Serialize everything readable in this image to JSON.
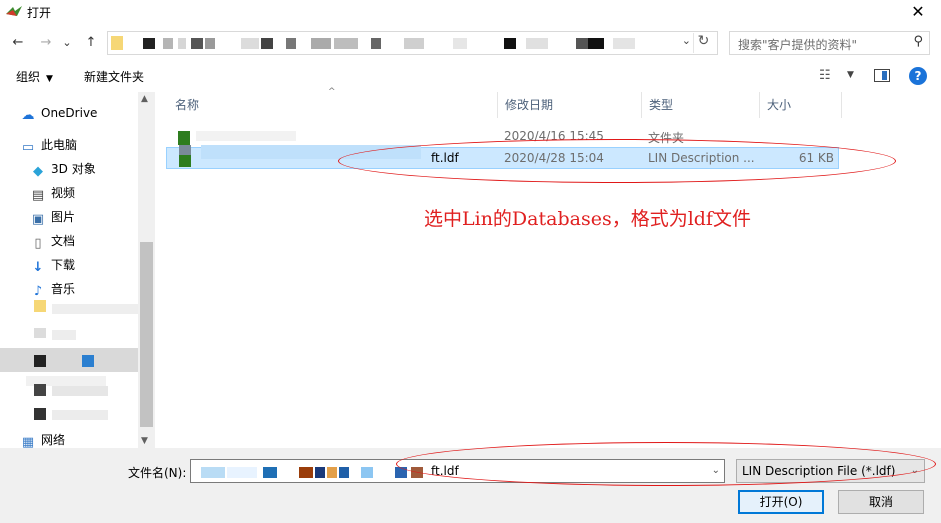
{
  "window": {
    "title": "打开",
    "close_glyph": "✕"
  },
  "nav": {
    "back_glyph": "←",
    "forward_glyph": "→",
    "recent_glyph": "⌄",
    "up_glyph": "↑",
    "address_drop_glyph": "⌄",
    "refresh_glyph": "↻",
    "search_placeholder": "搜索\"客户提供的资料\"",
    "search_glyph": "⚲"
  },
  "toolbar": {
    "organize": "组织",
    "organize_arrow": "▼",
    "new_folder": "新建文件夹",
    "view_glyph": "☷",
    "view_drop": "▼",
    "help": "?"
  },
  "sidebar": {
    "items": [
      {
        "label": "OneDrive",
        "icon": "cloud-icon",
        "glyph": "☁"
      },
      {
        "label": "此电脑",
        "icon": "computer-icon",
        "glyph": "▭"
      },
      {
        "label": "3D 对象",
        "icon": "cube-icon",
        "glyph": "◆"
      },
      {
        "label": "视频",
        "icon": "video-icon",
        "glyph": "▤"
      },
      {
        "label": "图片",
        "icon": "picture-icon",
        "glyph": "▣"
      },
      {
        "label": "文档",
        "icon": "document-icon",
        "glyph": "▯"
      },
      {
        "label": "下载",
        "icon": "download-icon",
        "glyph": "↓"
      },
      {
        "label": "音乐",
        "icon": "music-icon",
        "glyph": "♪"
      },
      {
        "label": "网络",
        "icon": "network-icon",
        "glyph": "▦"
      }
    ],
    "scroll_up": "▲",
    "scroll_down": "▼"
  },
  "columns": {
    "name": "名称",
    "date": "修改日期",
    "type": "类型",
    "size": "大小",
    "sort_glyph": "^"
  },
  "files": [
    {
      "name": "",
      "date": "2020/4/16 15:45",
      "type": "文件夹",
      "size": ""
    },
    {
      "name": "ft.ldf",
      "date": "2020/4/28 15:04",
      "type": "LIN Description ...",
      "size": "61 KB"
    }
  ],
  "annotation": "选中Lin的Databases，格式为ldf文件",
  "bottom": {
    "filename_label": "文件名(N):",
    "filename_value": "ft.ldf",
    "filename_drop": "⌄",
    "filter_value": "LIN Description File (*.ldf)",
    "filter_drop": "⌄",
    "open_label": "打开(O)",
    "cancel_label": "取消"
  },
  "colors": {
    "annotation_red": "#e02020",
    "selection_bg": "#cce8ff",
    "selection_border": "#99d1ff",
    "help_blue": "#1a73d9"
  }
}
